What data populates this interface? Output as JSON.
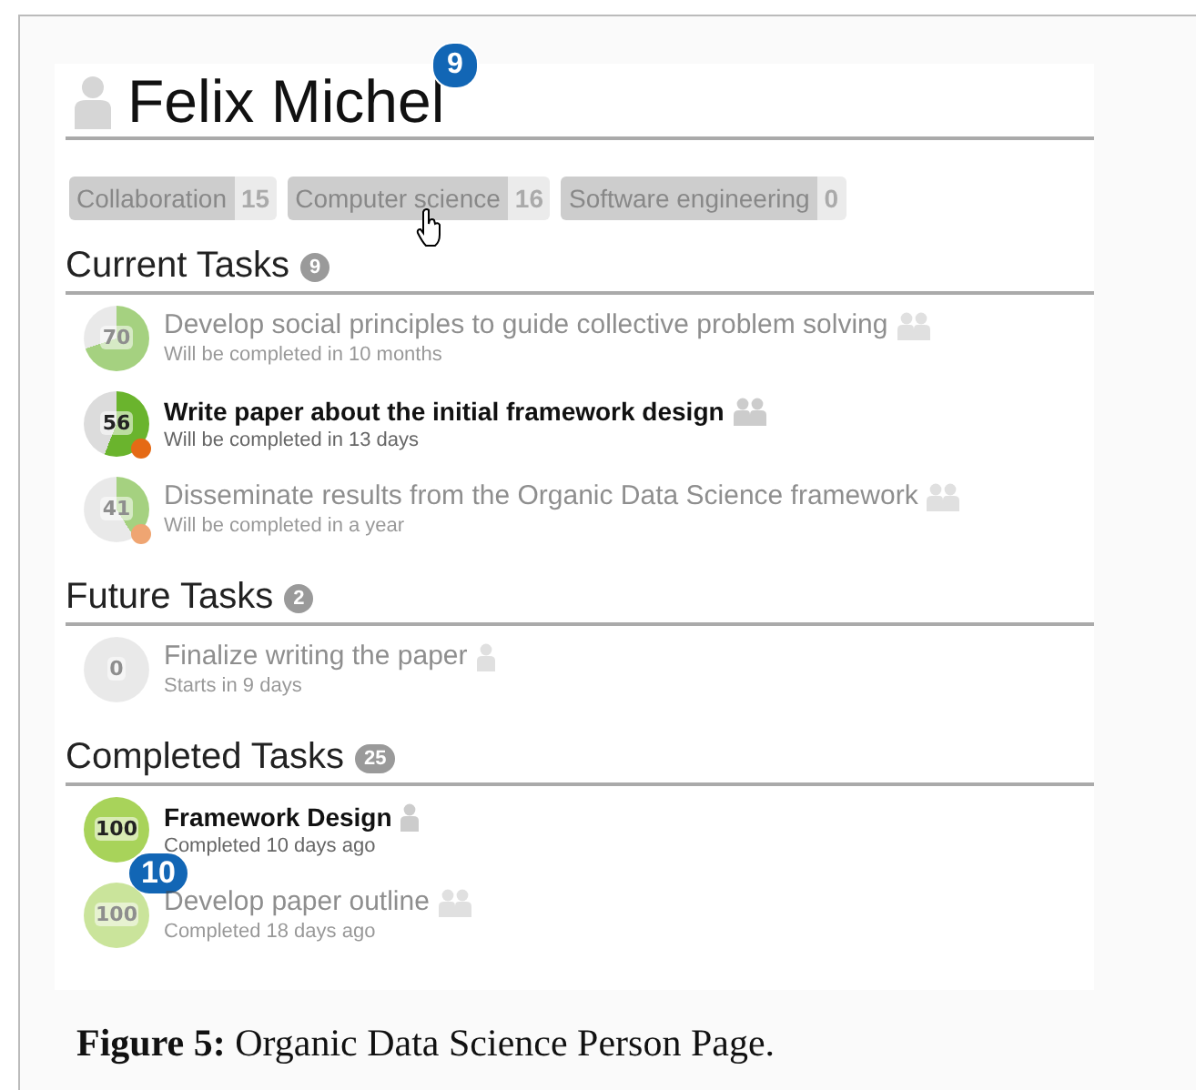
{
  "person": {
    "name": "Felix Michel",
    "callout": "9"
  },
  "tags": [
    {
      "label": "Collaboration",
      "count": "15",
      "hovered": false
    },
    {
      "label": "Computer science",
      "count": "16",
      "hovered": true
    },
    {
      "label": "Software engineering",
      "count": "0",
      "hovered": false
    }
  ],
  "sections": [
    {
      "title": "Current Tasks",
      "count": "9",
      "tasks": [
        {
          "title": "Develop social principles to guide collective problem solving",
          "subtitle": "Will be completed in 10 months",
          "progress": "70",
          "faded": true,
          "alert": false,
          "team": true
        },
        {
          "title": "Write paper about the initial framework design",
          "subtitle": "Will be completed in 13 days",
          "progress": "56",
          "faded": false,
          "alert": true,
          "team": true
        },
        {
          "title": "Disseminate results from the Organic Data Science framework",
          "subtitle": "Will be completed in a year",
          "progress": "41",
          "faded": true,
          "alert": true,
          "team": true
        }
      ]
    },
    {
      "title": "Future Tasks",
      "count": "2",
      "tasks": [
        {
          "title": "Finalize writing the paper",
          "subtitle": "Starts in 9 days",
          "progress": "0",
          "faded": true,
          "alert": false,
          "team": false
        }
      ]
    },
    {
      "title": "Completed Tasks",
      "count": "25",
      "tasks": [
        {
          "title": "Framework Design",
          "subtitle": "Completed 10 days ago",
          "progress": "100",
          "faded": false,
          "alert": false,
          "team": false,
          "callout": "10"
        },
        {
          "title": "Develop paper outline",
          "subtitle": "Completed 18 days ago",
          "progress": "100",
          "faded": true,
          "alert": false,
          "team": true
        }
      ]
    }
  ],
  "caption": "**Figure 5:** Organic Data Science Person Page."
}
